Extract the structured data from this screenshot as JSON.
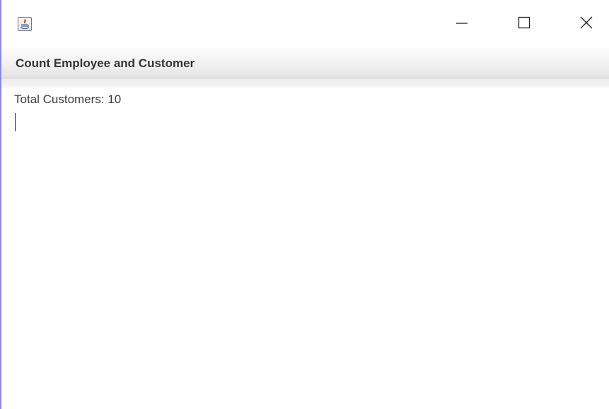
{
  "window": {
    "icon": "java-app-icon",
    "controls": {
      "minimize_icon": "minimize-icon",
      "maximize_icon": "maximize-icon",
      "close_icon": "close-icon"
    }
  },
  "menubar": {
    "title": "Count Employee and Customer"
  },
  "content": {
    "text": "Total Customers: 10"
  },
  "colors": {
    "border_accent": "#8a8ad6",
    "text": "#3b3b3b",
    "menubar_text": "#333333"
  }
}
